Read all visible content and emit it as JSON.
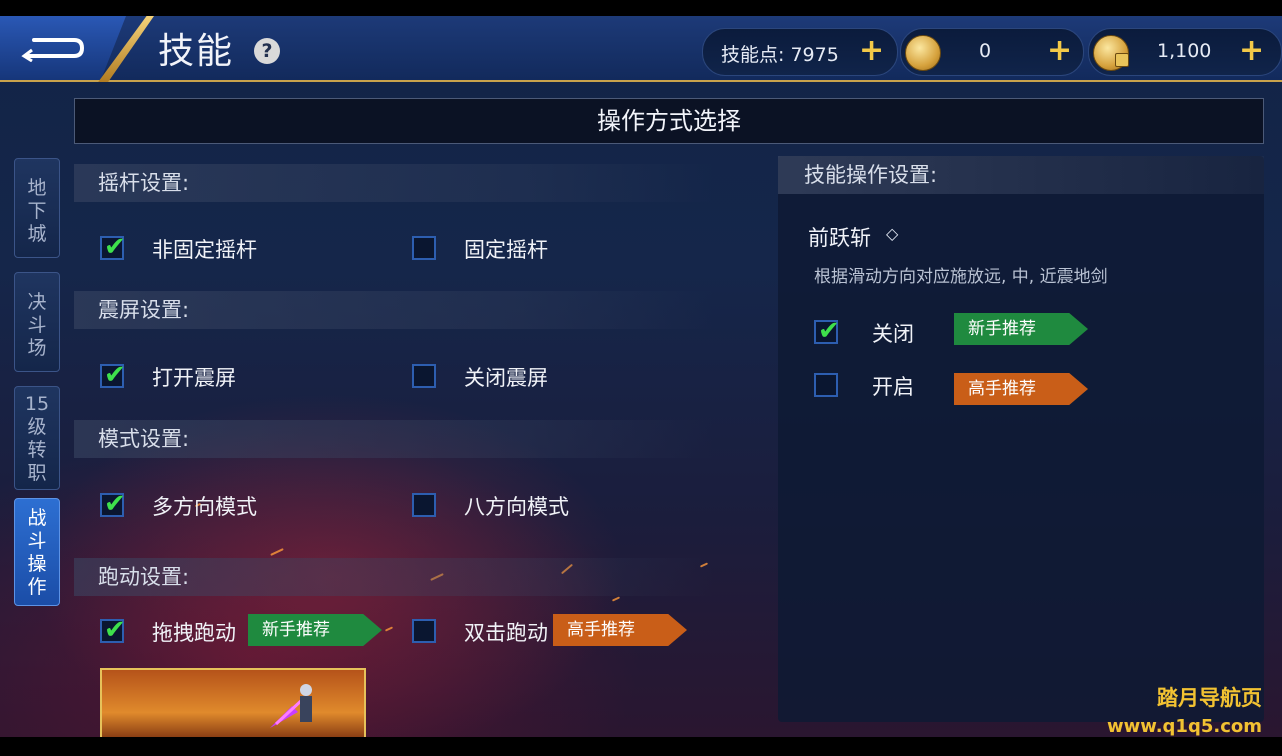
{
  "header": {
    "title": "技能",
    "help_symbol": "?",
    "skill_points_label": "技能点: 7975",
    "gold_value": "0",
    "locked_gold_value": "1,100",
    "plus_symbol": "+"
  },
  "panel_title": "操作方式选择",
  "side_tabs": [
    {
      "label_lines": [
        "地",
        "下",
        "城"
      ],
      "active": false
    },
    {
      "label_lines": [
        "决",
        "斗",
        "场"
      ],
      "active": false
    },
    {
      "label_lines": [
        "15",
        "级",
        "转",
        "职"
      ],
      "active": false
    },
    {
      "label_lines": [
        "战",
        "斗",
        "操",
        "作"
      ],
      "active": true
    }
  ],
  "sections": {
    "joystick": {
      "heading": "摇杆设置:",
      "options": [
        {
          "label": "非固定摇杆",
          "checked": true
        },
        {
          "label": "固定摇杆",
          "checked": false
        }
      ]
    },
    "shake": {
      "heading": "震屏设置:",
      "options": [
        {
          "label": "打开震屏",
          "checked": true
        },
        {
          "label": "关闭震屏",
          "checked": false
        }
      ]
    },
    "mode": {
      "heading": "模式设置:",
      "options": [
        {
          "label": "多方向模式",
          "checked": true
        },
        {
          "label": "八方向模式",
          "checked": false
        }
      ]
    },
    "run": {
      "heading": "跑动设置:",
      "options": [
        {
          "label": "拖拽跑动",
          "checked": true,
          "badge": "新手推荐"
        },
        {
          "label": "双击跑动",
          "checked": false,
          "badge": "高手推荐"
        }
      ]
    }
  },
  "skill_settings": {
    "heading": "技能操作设置:",
    "skill_name": "前跃斩",
    "diamond": "◇",
    "description": "根据滑动方向对应施放远, 中, 近震地剑",
    "options": [
      {
        "label": "关闭",
        "checked": true,
        "badge": "新手推荐"
      },
      {
        "label": "开启",
        "checked": false,
        "badge": "高手推荐"
      }
    ]
  },
  "checkmark": "✔",
  "watermark": {
    "line1": "踏月导航页",
    "line2": "www.q1q5.com"
  },
  "colors": {
    "badge_green": "#1f8a3f",
    "badge_orange": "#c95e18",
    "check_green": "#3ee04c",
    "gold_accent": "#f3c948",
    "active_tab": "#2d6fd2"
  }
}
